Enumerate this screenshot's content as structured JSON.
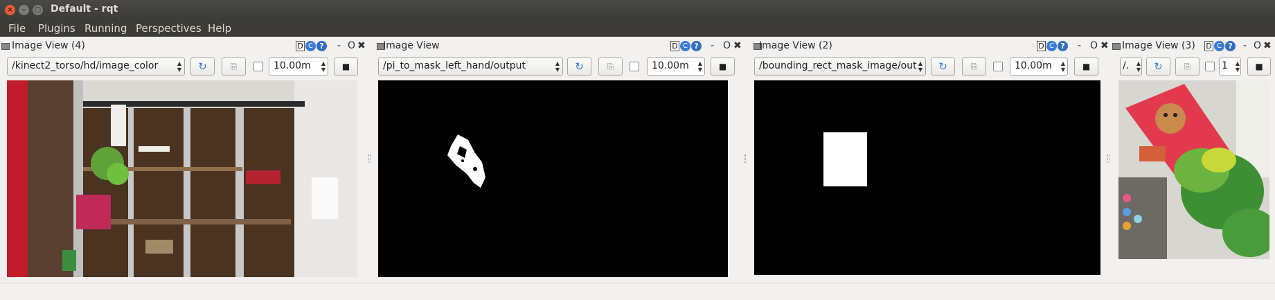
{
  "window": {
    "title": "Default - rqt",
    "close": "×",
    "minimize": "–",
    "maximize": "□"
  },
  "menu": [
    "File",
    "Plugins",
    "Running",
    "Perspectives",
    "Help"
  ],
  "panels": [
    {
      "title": "Image View (4)",
      "topic": "/kinect2_torso/hd/image_color",
      "timeout": "10.00m",
      "content": "camera"
    },
    {
      "title": "Image View",
      "topic": "/pi_to_mask_left_hand/output",
      "timeout": "10.00m",
      "content": "mask-blob"
    },
    {
      "title": "Image View (2)",
      "topic": "/bounding_rect_mask_image/out",
      "timeout": "10.00m",
      "content": "rect"
    },
    {
      "title": "Image View (3)",
      "topic": "/.",
      "timeout": "1",
      "content": "toy-photo"
    }
  ],
  "dock_controls": {
    "d": "D",
    "c": "C",
    "q": "?",
    "dash": "-",
    "o": "O",
    "x": "✖"
  },
  "colors": {
    "titlebar": "#3c3b37",
    "menu_text": "#dfdbd2",
    "close_button": "#e35d34",
    "refresh_icon": "#3a7bd5"
  }
}
